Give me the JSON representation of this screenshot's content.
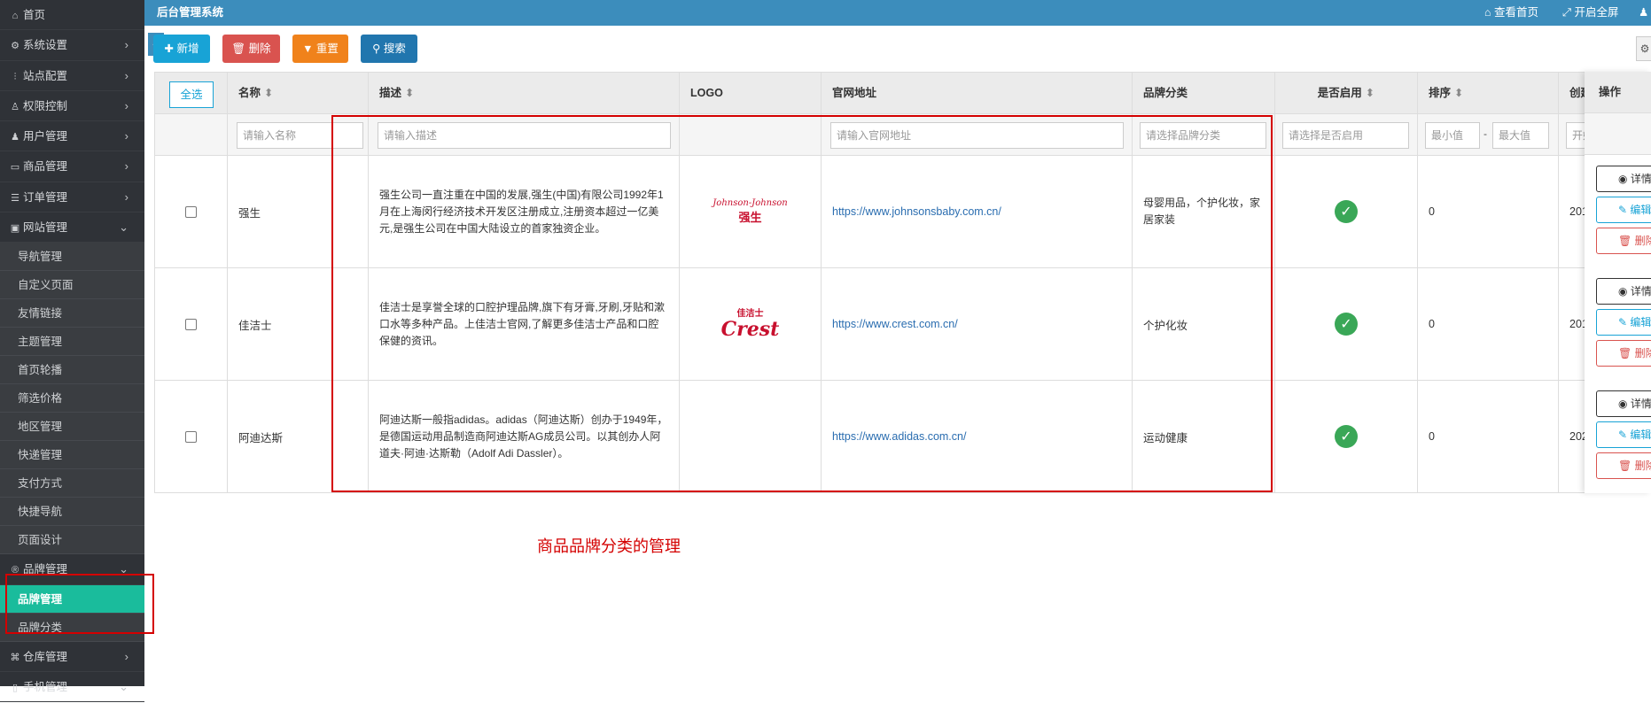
{
  "app": {
    "title": "后台管理系统"
  },
  "topbar": {
    "view_home": "查看首页",
    "fullscreen": "开启全屏",
    "user_icon": "user-icon"
  },
  "sidebar": {
    "items": [
      {
        "label": "首页",
        "icon": "home-icon",
        "arrow": ""
      },
      {
        "label": "系统设置",
        "icon": "gear-icon",
        "arrow": "›"
      },
      {
        "label": "站点配置",
        "icon": "sliders-icon",
        "arrow": "›"
      },
      {
        "label": "权限控制",
        "icon": "user-icon",
        "arrow": "›"
      },
      {
        "label": "用户管理",
        "icon": "users-icon",
        "arrow": "›"
      },
      {
        "label": "商品管理",
        "icon": "box-icon",
        "arrow": "›"
      },
      {
        "label": "订单管理",
        "icon": "list-icon",
        "arrow": "›"
      },
      {
        "label": "网站管理",
        "icon": "browser-icon",
        "arrow": "⌄"
      }
    ],
    "website_sub": [
      "导航管理",
      "自定义页面",
      "友情链接",
      "主题管理",
      "首页轮播",
      "筛选价格",
      "地区管理",
      "快递管理",
      "支付方式",
      "快捷导航",
      "页面设计"
    ],
    "brand": {
      "label": "品牌管理",
      "icon": "registered-icon",
      "arrow": "⌄"
    },
    "brand_sub": [
      "品牌管理",
      "品牌分类"
    ],
    "bottom_items": [
      {
        "label": "仓库管理",
        "icon": "sitemap-icon",
        "arrow": "›"
      },
      {
        "label": "手机管理",
        "icon": "mobile-icon",
        "arrow": "⌄"
      }
    ]
  },
  "toolbar": {
    "add": "新增",
    "delete": "删除",
    "reset": "重置",
    "search": "搜索"
  },
  "table": {
    "select_all": "全选",
    "headers": {
      "name": "名称",
      "desc": "描述",
      "logo": "LOGO",
      "url": "官网地址",
      "category": "品牌分类",
      "enabled": "是否启用",
      "sort": "排序",
      "created": "创建",
      "actions": "操作"
    },
    "filters": {
      "name": "请输入名称",
      "desc": "请输入描述",
      "url": "请输入官网地址",
      "category": "请选择品牌分类",
      "enabled": "请选择是否启用",
      "sort_min": "最小值",
      "sort_sep": "-",
      "sort_max": "最大值",
      "created": "开始"
    },
    "rows": [
      {
        "name": "强生",
        "desc": "强生公司一直注重在中国的发展,强生(中国)有限公司1992年1月在上海闵行经济技术开发区注册成立,注册资本超过一亿美元,是强生公司在中国大陆设立的首家独资企业。",
        "logo_top": "Johnson-Johnson",
        "logo_bottom": "强生",
        "url": "https://www.johnsonsbaby.com.cn/",
        "category": "母婴用品，个护化妆，家居家装",
        "sort": "0",
        "created": "201"
      },
      {
        "name": "佳洁士",
        "desc": "佳洁士是享誉全球的口腔护理品牌,旗下有牙膏,牙刷,牙贴和漱口水等多种产品。上佳洁士官网,了解更多佳洁士产品和口腔保健的资讯。",
        "logo_top": "佳洁士",
        "logo_bottom": "Crest",
        "url": "https://www.crest.com.cn/",
        "category": "个护化妆",
        "sort": "0",
        "created": "201"
      },
      {
        "name": "阿迪达斯",
        "desc": "阿迪达斯一般指adidas。adidas（阿迪达斯）创办于1949年，是德国运动用品制造商阿迪达斯AG成员公司。以其创办人阿道夫·阿迪·达斯勒（Adolf Adi Dassler）。",
        "logo_top": "",
        "logo_bottom": "",
        "url": "https://www.adidas.com.cn/",
        "category": "运动健康",
        "sort": "0",
        "created": "202"
      }
    ],
    "action_labels": {
      "view": "详情",
      "edit": "编辑",
      "remove": "删除"
    }
  },
  "annotation": "商品品牌分类的管理"
}
